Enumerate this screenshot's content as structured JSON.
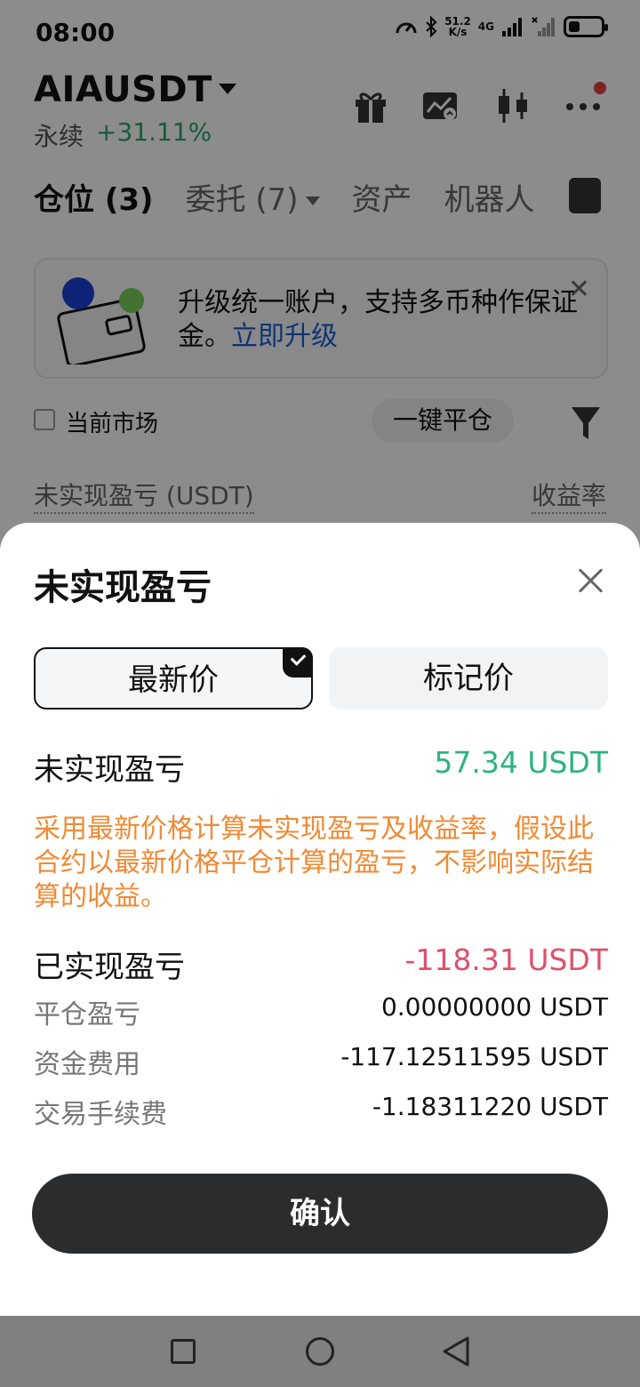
{
  "status_bar": {
    "time": "08:00",
    "net_speed_value": "51.2",
    "net_speed_unit": "K/s",
    "network": "4G",
    "battery_level": 0.35
  },
  "header": {
    "symbol": "AIAUSDT",
    "contract_type": "永续",
    "change": "+31.11%"
  },
  "tabs": [
    {
      "label": "仓位 (3)",
      "active": true
    },
    {
      "label": "委托 (7)",
      "has_dropdown": true
    },
    {
      "label": "资产"
    },
    {
      "label": "机器人"
    }
  ],
  "banner": {
    "text": "升级统一账户，支持多币种作保证金。",
    "link": "立即升级"
  },
  "filter": {
    "current_market_label": "当前市场",
    "close_all_label": "一键平仓"
  },
  "summary": {
    "unrealized_label": "未实现盈亏 (USDT)",
    "roi_label": "收益率"
  },
  "sheet": {
    "title": "未实现盈亏",
    "segments": {
      "latest": "最新价",
      "mark": "标记价"
    },
    "unrealized_label": "未实现盈亏",
    "unrealized_value": "57.34 USDT",
    "note": "采用最新价格计算未实现盈亏及收益率，假设此合约以最新价格平仓计算的盈亏，不影响实际结算的收益。",
    "realized_label": "已实现盈亏",
    "realized_value": "-118.31 USDT",
    "details": [
      {
        "label": "平仓盈亏",
        "value": "0.00000000 USDT"
      },
      {
        "label": "资金费用",
        "value": "-117.12511595 USDT"
      },
      {
        "label": "交易手续费",
        "value": "-1.18311220 USDT"
      }
    ],
    "confirm_label": "确认"
  },
  "colors": {
    "positive": "#2db37f",
    "negative": "#e0506a",
    "note": "#f08a35",
    "link": "#1a5fd6",
    "button": "#2b2c2e"
  }
}
